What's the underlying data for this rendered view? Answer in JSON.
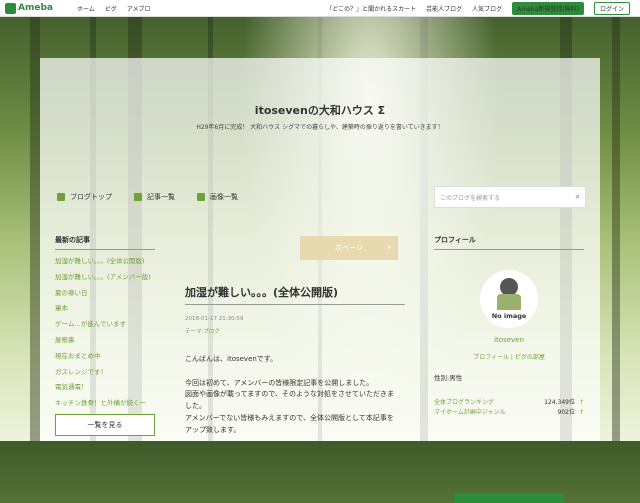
{
  "topbar": {
    "logo": "Ameba",
    "nav": [
      "ホーム",
      "ピグ",
      "アメブロ"
    ],
    "links": [
      "「どこの？」と聞かれるスカート",
      "芸能人ブログ",
      "人気ブログ"
    ],
    "register": "Ameba新規登録(無料)",
    "login": "ログイン"
  },
  "blog": {
    "title": "itosevenの大和ハウス Σ",
    "description": "H29年6月に完成！ 大和ハウス シグマでの暮らしや、建築時の振り返りを書いていきます！"
  },
  "gnav": [
    "ブログトップ",
    "記事一覧",
    "画像一覧"
  ],
  "search": {
    "placeholder": "このブログを検索する"
  },
  "recent": {
    "heading": "最新の記事",
    "items": [
      "加湿が難しい。。。(全体公開版)",
      "加湿が難しい。。。(アメンバー版)",
      "夏の寒い日",
      "童本",
      "ゲーム…が進んでいます",
      "屋根裏",
      "現在おまとめ中",
      "ガスレンジです！",
      "電気通電！",
      "キッチン鉄骨！と外構が続くー"
    ],
    "more": "一覧を見る"
  },
  "post": {
    "next": "次ページ",
    "title": "加湿が難しい。。。(全体公開版)",
    "date": "2018-01-17 21:30:59",
    "theme_label": "テーマ:",
    "theme": "ブログ",
    "lines": [
      "こんばんは、itosevenです。",
      "",
      "今回は初めて、アメンバーの皆様限定記事を公開しました。",
      "図面や画像が載ってますので、そのような対処をさせていただきま",
      "した。",
      "アメンバーでない皆様もみえますので、全体公開版として本記事を",
      "アップ致します。"
    ]
  },
  "profile": {
    "heading": "プロフィール",
    "noimage": "No image",
    "name": "itoseven",
    "links": "プロフィール | ピグの部屋",
    "gender": "性別:男性",
    "ranks": [
      {
        "label": "全体ブログランキング",
        "value": "124,349位"
      },
      {
        "label": "マイホーム計画中ジャンル",
        "value": "902位"
      }
    ]
  }
}
